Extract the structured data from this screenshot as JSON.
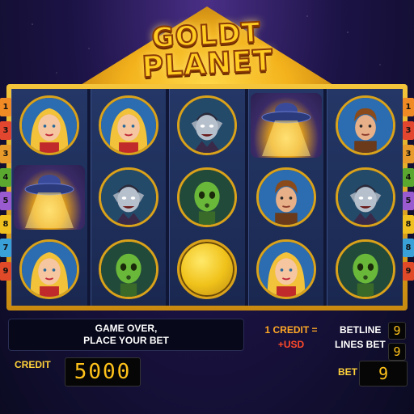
{
  "logo": {
    "line1": "GOLDT",
    "line2": "PLANET"
  },
  "colors": {
    "gold": "#f4c53a",
    "frame_bg": "#0f1636",
    "lcd_digit": "#ffc21a"
  },
  "reels": [
    [
      "blonde-woman",
      "ufo",
      "blonde-woman"
    ],
    [
      "blonde-woman",
      "vampire",
      "green-alien"
    ],
    [
      "vampire",
      "green-alien",
      "gold-orb"
    ],
    [
      "ufo",
      "man",
      "blonde-woman"
    ],
    [
      "man",
      "vampire",
      "green-alien"
    ]
  ],
  "paylines_left": [
    {
      "num": "1",
      "color": "#f08a24"
    },
    {
      "num": "3",
      "color": "#e2462e"
    },
    {
      "num": "3",
      "color": "#e89a2a"
    },
    {
      "num": "4",
      "color": "#5aa830"
    },
    {
      "num": "5",
      "color": "#9a5ad0"
    },
    {
      "num": "8",
      "color": "#f0c020"
    },
    {
      "num": "7",
      "color": "#3aa0d8"
    },
    {
      "num": "9",
      "color": "#e04a28"
    }
  ],
  "paylines_right": [
    {
      "num": "1",
      "color": "#f08a24"
    },
    {
      "num": "3",
      "color": "#e2462e"
    },
    {
      "num": "3",
      "color": "#e89a2a"
    },
    {
      "num": "4",
      "color": "#5aa830"
    },
    {
      "num": "5",
      "color": "#9a5ad0"
    },
    {
      "num": "8",
      "color": "#f0c020"
    },
    {
      "num": "8",
      "color": "#3aa0d8"
    },
    {
      "num": "9",
      "color": "#e04a28"
    }
  ],
  "message": {
    "line1": "GAME OVER,",
    "line2": "PLACE YOUR BET"
  },
  "credit": {
    "label": "CREDIT",
    "value": "5000"
  },
  "rate": {
    "line1": "1 CREDIT =",
    "line2": "+USD"
  },
  "betline": {
    "label": "BETLINE",
    "value": "9"
  },
  "lines_bet": {
    "label": "LINES BET",
    "value": "9"
  },
  "bet": {
    "label": "BET",
    "value": "9"
  }
}
